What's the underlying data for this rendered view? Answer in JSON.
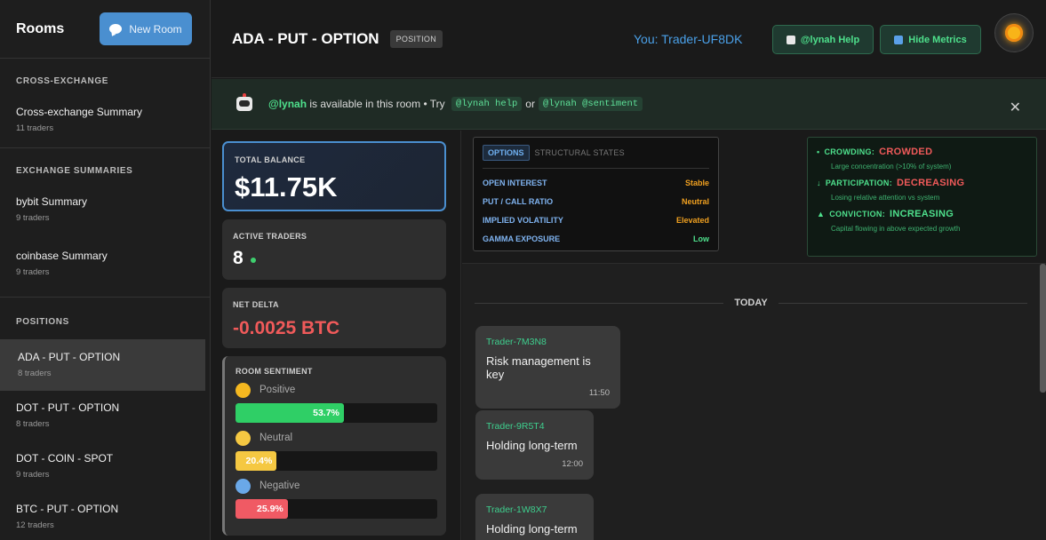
{
  "sidebar": {
    "title": "Rooms",
    "new_room_label": "New Room",
    "sections": [
      {
        "title": "CROSS-EXCHANGE",
        "items": [
          {
            "name": "Cross-exchange Summary",
            "sub": "11 traders"
          }
        ]
      },
      {
        "title": "EXCHANGE SUMMARIES",
        "items": [
          {
            "name": "bybit Summary",
            "sub": "9 traders"
          },
          {
            "name": "coinbase Summary",
            "sub": "9 traders"
          }
        ]
      },
      {
        "title": "POSITIONS",
        "items": [
          {
            "name": "ADA - PUT - OPTION",
            "sub": "8 traders"
          },
          {
            "name": "DOT - PUT - OPTION",
            "sub": "8 traders"
          },
          {
            "name": "DOT - COIN - SPOT",
            "sub": "9 traders"
          },
          {
            "name": "BTC - PUT - OPTION",
            "sub": "12 traders"
          }
        ]
      }
    ]
  },
  "header": {
    "title": "ADA - PUT - OPTION",
    "badge": "POSITION",
    "user": "You: Trader-UF8DK",
    "help_label": "@lynah Help",
    "metrics_label": "Hide Metrics"
  },
  "banner": {
    "bot": "@lynah",
    "text1": " is available in this room • Try ",
    "cmd1": "@lynah help",
    "or": "or",
    "cmd2": "@lynah @sentiment",
    "close": "✕"
  },
  "metrics": {
    "balance_label": "TOTAL BALANCE",
    "balance_value": "$11.75K",
    "traders_label": "ACTIVE TRADERS",
    "traders_value": "8",
    "delta_label": "NET DELTA",
    "delta_value": "-0.0025 BTC",
    "sentiment_label": "ROOM SENTIMENT",
    "sentiment": [
      {
        "label": "Positive",
        "pct": 53.7,
        "pct_text": "53.7%",
        "color": "#2fcf66"
      },
      {
        "label": "Neutral",
        "pct": 20.4,
        "pct_text": "20.4%",
        "color": "#f5c842"
      },
      {
        "label": "Negative",
        "pct": 25.9,
        "pct_text": "25.9%",
        "color": "#f05a64"
      }
    ]
  },
  "options": {
    "tab_active": "OPTIONS",
    "tab_other": "STRUCTURAL STATES",
    "rows": [
      {
        "key": "OPEN INTEREST",
        "value": "Stable",
        "color": "#f0a020"
      },
      {
        "key": "PUT / CALL RATIO",
        "value": "Neutral",
        "color": "#f0a020"
      },
      {
        "key": "IMPLIED VOLATILITY",
        "value": "Elevated",
        "color": "#f0a020"
      },
      {
        "key": "GAMMA EXPOSURE",
        "value": "Low",
        "color": "#4ee08c"
      }
    ]
  },
  "signals": [
    {
      "icon": "•",
      "label": "CROWDING:",
      "value": "CROWDED",
      "value_color": "#f05a5a",
      "sub": "Large concentration (>10% of system)"
    },
    {
      "icon": "↓",
      "label": "PARTICIPATION:",
      "value": "DECREASING",
      "value_color": "#f05a5a",
      "sub": "Losing relative attention vs system"
    },
    {
      "icon": "▲",
      "label": "CONVICTION:",
      "value": "INCREASING",
      "value_color": "#4ee08c",
      "sub": "Capital flowing in above expected growth"
    }
  ],
  "chat": {
    "divider": "TODAY",
    "messages": [
      {
        "user": "Trader-7M3N8",
        "text": "Risk management is key",
        "time": "11:50"
      },
      {
        "user": "Trader-9R5T4",
        "text": "Holding long-term",
        "time": "12:00"
      },
      {
        "user": "Trader-1W8X7",
        "text": "Holding long-term",
        "time": ""
      }
    ]
  }
}
